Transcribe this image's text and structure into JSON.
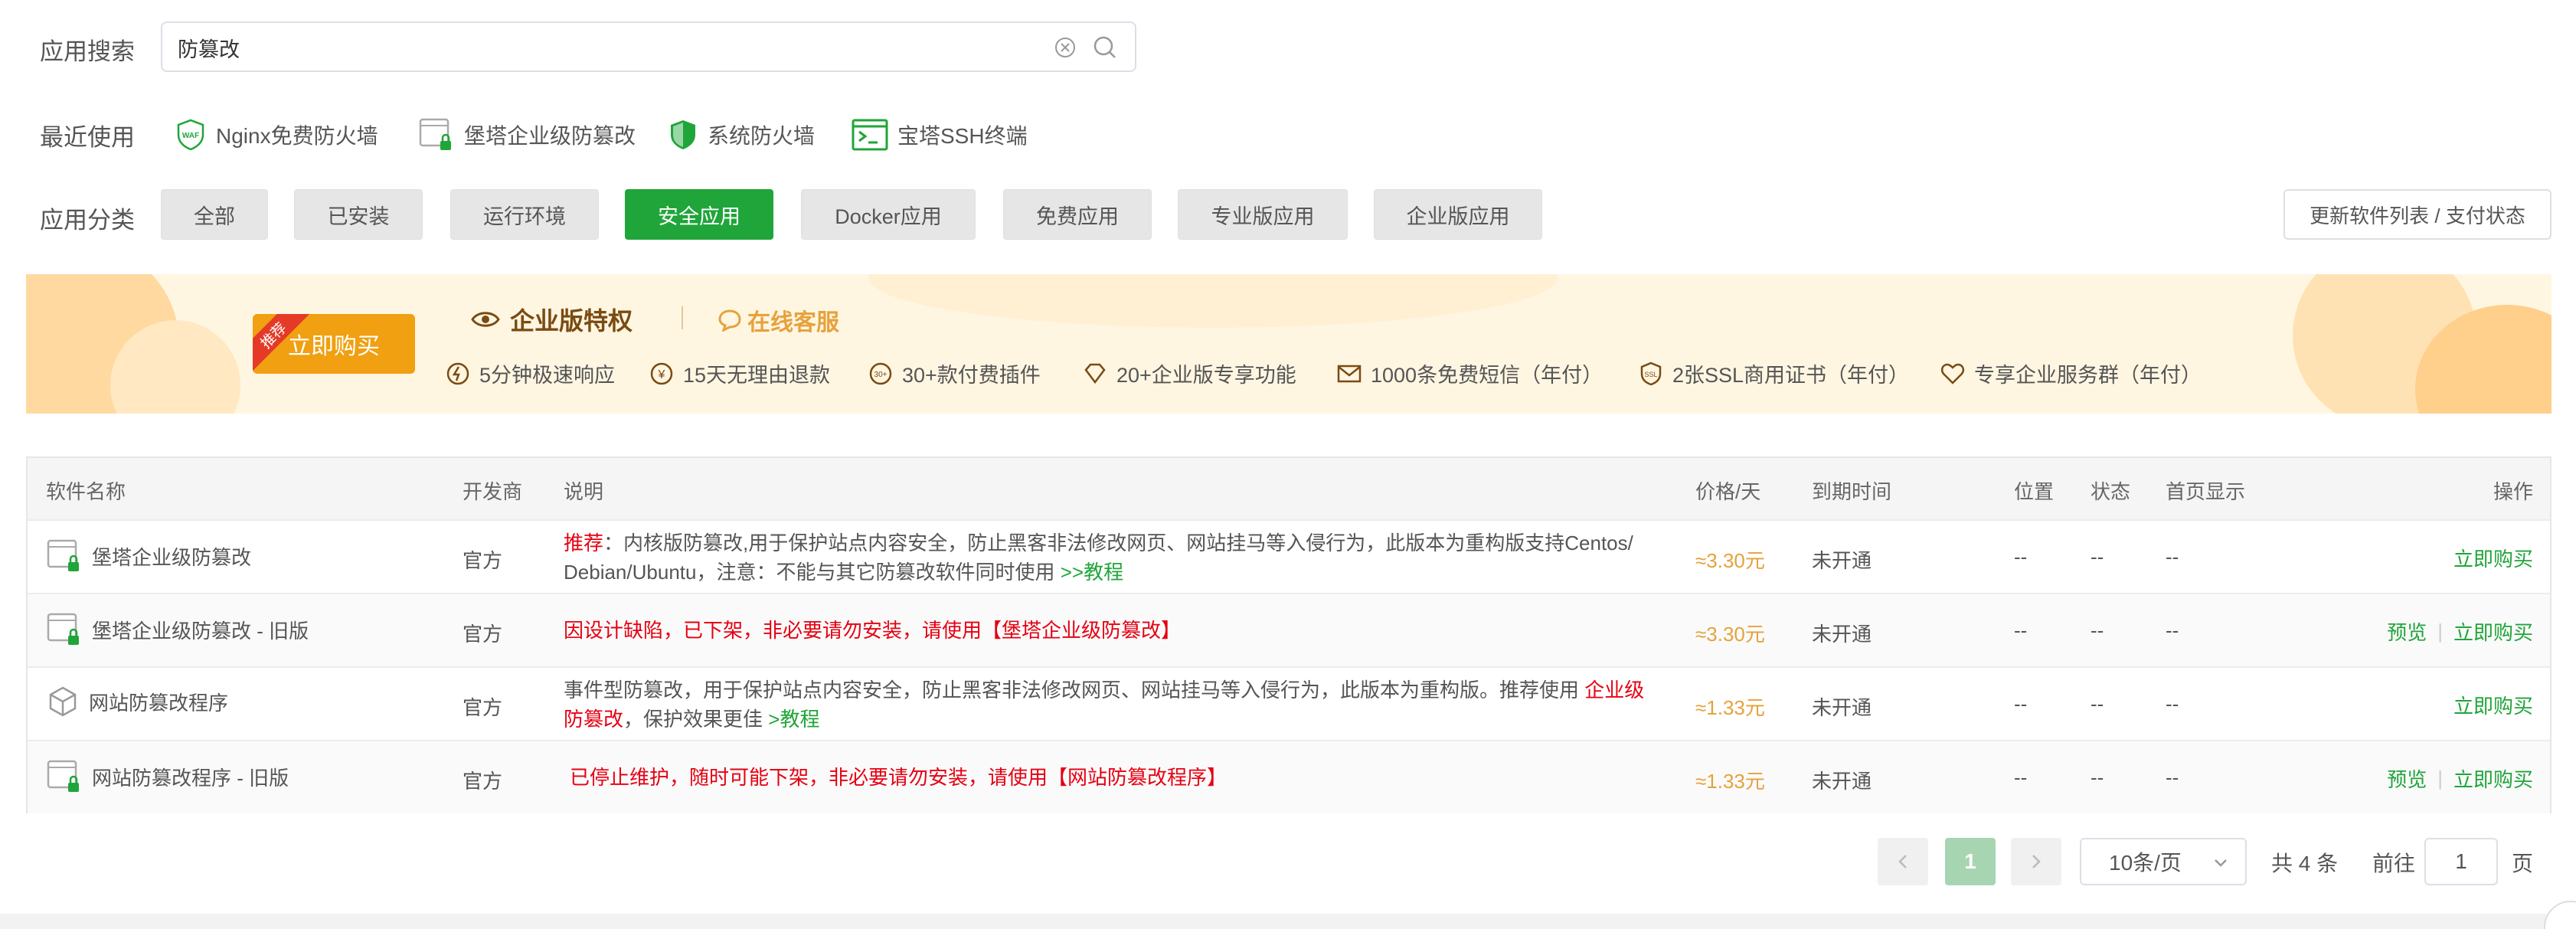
{
  "search": {
    "label": "应用搜索",
    "value": "防篡改"
  },
  "recent": {
    "label": "最近使用",
    "items": [
      {
        "label": "Nginx免费防火墙",
        "icon": "waf-shield-icon"
      },
      {
        "label": "堡塔企业级防篡改",
        "icon": "lock-window-icon"
      },
      {
        "label": "系统防火墙",
        "icon": "shield-icon"
      },
      {
        "label": "宝塔SSH终端",
        "icon": "terminal-icon"
      }
    ]
  },
  "category": {
    "label": "应用分类",
    "items": [
      "全部",
      "已安装",
      "运行环境",
      "安全应用",
      "Docker应用",
      "免费应用",
      "专业版应用",
      "企业版应用"
    ],
    "active": "安全应用",
    "refresh_label": "更新软件列表 / 支付状态"
  },
  "banner": {
    "ribbon": "推荐",
    "buy_label": "立即购买",
    "title": "企业版特权",
    "service": "在线客服",
    "features": [
      "5分钟极速响应",
      "15天无理由退款",
      "30+款付费插件",
      "20+企业版专享功能",
      "1000条免费短信（年付）",
      "2张SSL商用证书（年付）",
      "专享企业服务群（年付）"
    ]
  },
  "table": {
    "headers": {
      "name": "软件名称",
      "dev": "开发商",
      "desc": "说明",
      "price": "价格/天",
      "expire": "到期时间",
      "pos": "位置",
      "status": "状态",
      "home": "首页显示",
      "op": "操作"
    },
    "rows": [
      {
        "name": "堡塔企业级防篡改",
        "dev": "官方",
        "desc_prefix": "推荐",
        "desc_colon": "：",
        "desc_line1": "内核版防篡改,用于保护站点内容安全，防止黑客非法修改网页、网站挂马等入侵行为，此版本为重构版支持Centos/",
        "desc_line2": "Debian/Ubuntu，注意：不能与其它防篡改软件同时使用",
        "desc_link": ">>教程",
        "price": "≈3.30元",
        "expire": "未开通",
        "pos": "--",
        "status": "--",
        "home": "--",
        "op_buy": "立即购买"
      },
      {
        "name": "堡塔企业级防篡改 - 旧版",
        "dev": "官方",
        "desc": "因设计缺陷，已下架，非必要请勿安装，请使用【堡塔企业级防篡改】",
        "price": "≈3.30元",
        "expire": "未开通",
        "pos": "--",
        "status": "--",
        "home": "--",
        "op_preview": "预览",
        "op_buy": "立即购买"
      },
      {
        "name": "网站防篡改程序",
        "dev": "官方",
        "desc_line1": "事件型防篡改，用于保护站点内容安全，防止黑客非法修改网页、网站挂马等入侵行为，此版本为重构版。推荐使用",
        "desc_red1": "企业级",
        "desc_red2": "防篡改",
        "desc_line2": "，保护效果更佳",
        "desc_link": ">教程",
        "price": "≈1.33元",
        "expire": "未开通",
        "pos": "--",
        "status": "--",
        "home": "--",
        "op_buy": "立即购买"
      },
      {
        "name": "网站防篡改程序 - 旧版",
        "dev": "官方",
        "desc": "已停止维护，随时可能下架，非必要请勿安装，请使用【网站防篡改程序】",
        "price": "≈1.33元",
        "expire": "未开通",
        "pos": "--",
        "status": "--",
        "home": "--",
        "op_preview": "预览",
        "op_buy": "立即购买"
      }
    ]
  },
  "pagination": {
    "current": "1",
    "page_size": "10条/页",
    "total": "共 4 条",
    "goto_prefix": "前往",
    "goto_value": "1",
    "goto_suffix": "页"
  },
  "colors": {
    "accent": "#20a53a",
    "danger": "#e60012",
    "price": "#e6a23c"
  }
}
